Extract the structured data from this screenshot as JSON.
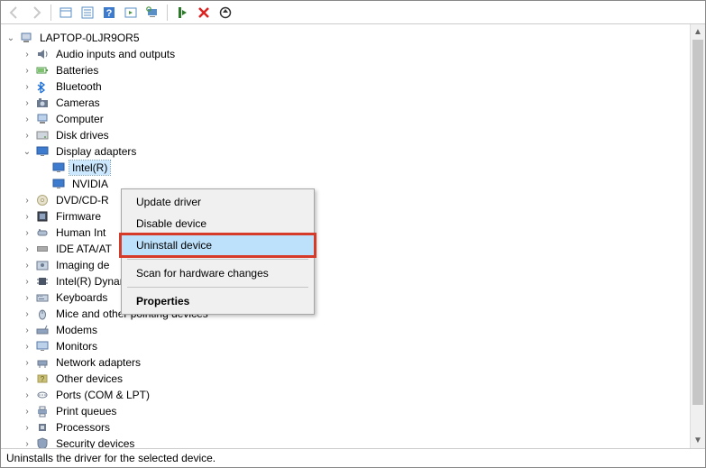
{
  "toolbar": {
    "back": "back-icon",
    "fwd": "forward-icon"
  },
  "tree": {
    "root": "LAPTOP-0LJR9OR5",
    "nodes": [
      {
        "label": "Audio inputs and outputs",
        "icon": "audio"
      },
      {
        "label": "Batteries",
        "icon": "battery"
      },
      {
        "label": "Bluetooth",
        "icon": "bluetooth"
      },
      {
        "label": "Cameras",
        "icon": "camera"
      },
      {
        "label": "Computer",
        "icon": "computer"
      },
      {
        "label": "Disk drives",
        "icon": "disk"
      },
      {
        "label": "Display adapters",
        "icon": "display",
        "expanded": true,
        "children": [
          {
            "label": "Intel(R)",
            "icon": "display",
            "selected": true
          },
          {
            "label": "NVIDIA",
            "icon": "display"
          }
        ]
      },
      {
        "label": "DVD/CD-R",
        "icon": "dvd"
      },
      {
        "label": "Firmware",
        "icon": "firmware"
      },
      {
        "label": "Human Int",
        "icon": "hid"
      },
      {
        "label": "IDE ATA/AT",
        "icon": "ide"
      },
      {
        "label": "Imaging de",
        "icon": "imaging"
      },
      {
        "label": "Intel(R) Dynamic Platform and Thermal Framework",
        "icon": "chip"
      },
      {
        "label": "Keyboards",
        "icon": "keyboard"
      },
      {
        "label": "Mice and other pointing devices",
        "icon": "mouse"
      },
      {
        "label": "Modems",
        "icon": "modem"
      },
      {
        "label": "Monitors",
        "icon": "monitor"
      },
      {
        "label": "Network adapters",
        "icon": "network"
      },
      {
        "label": "Other devices",
        "icon": "other"
      },
      {
        "label": "Ports (COM & LPT)",
        "icon": "ports"
      },
      {
        "label": "Print queues",
        "icon": "printer"
      },
      {
        "label": "Processors",
        "icon": "cpu"
      },
      {
        "label": "Security devices",
        "icon": "security"
      }
    ]
  },
  "contextMenu": {
    "items": [
      {
        "label": "Update driver"
      },
      {
        "label": "Disable device"
      },
      {
        "label": "Uninstall device",
        "highlight": true
      },
      {
        "sep": true
      },
      {
        "label": "Scan for hardware changes"
      },
      {
        "sep": true
      },
      {
        "label": "Properties",
        "bold": true
      }
    ]
  },
  "status": "Uninstalls the driver for the selected device."
}
